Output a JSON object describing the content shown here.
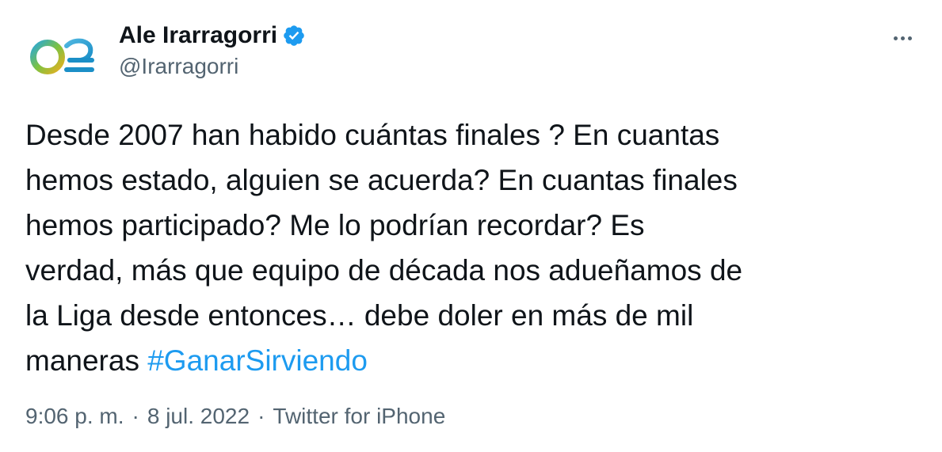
{
  "author": {
    "display_name": "Ale Irarragorri",
    "handle": "@Irarragorri",
    "verified": true,
    "avatar_icon": "o2-logo-icon"
  },
  "tweet": {
    "text": "Desde 2007 han habido cuántas finales ? En cuantas\nhemos estado, alguien se acuerda? En cuantas finales\nhemos participado? Me lo podrían recordar? Es\nverdad, más que equipo de década nos adueñamos de\nla Liga desde entonces… debe doler en más de mil\nmaneras ",
    "hashtag": "#GanarSirviendo"
  },
  "meta": {
    "time": "9:06 p. m.",
    "date": "8 jul. 2022",
    "source": "Twitter for iPhone"
  },
  "colors": {
    "accent": "#1d9bf0",
    "text": "#0f1419",
    "secondary": "#536471"
  }
}
